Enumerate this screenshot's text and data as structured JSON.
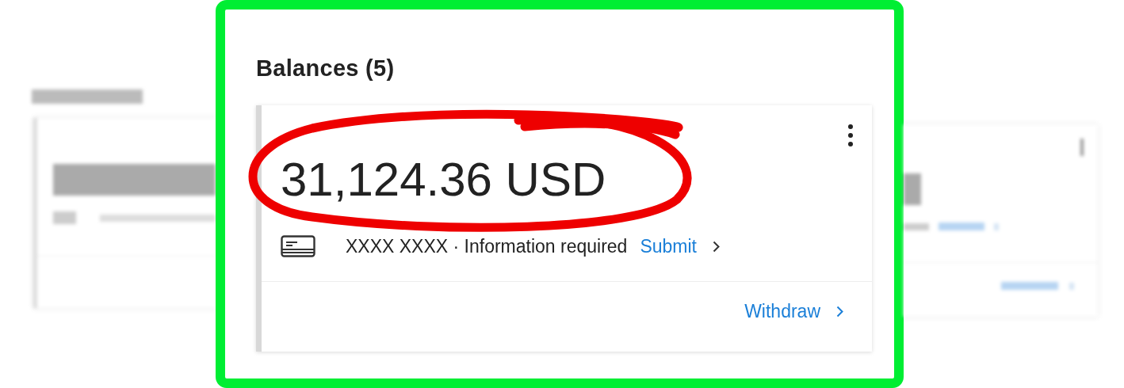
{
  "zoomed": {
    "heading": "Balances (5)",
    "card": {
      "amount": "31,124.36 USD",
      "account": "XXXX XXXX · Information required",
      "submit_link": "Submit",
      "withdraw_link": "Withdraw"
    }
  }
}
